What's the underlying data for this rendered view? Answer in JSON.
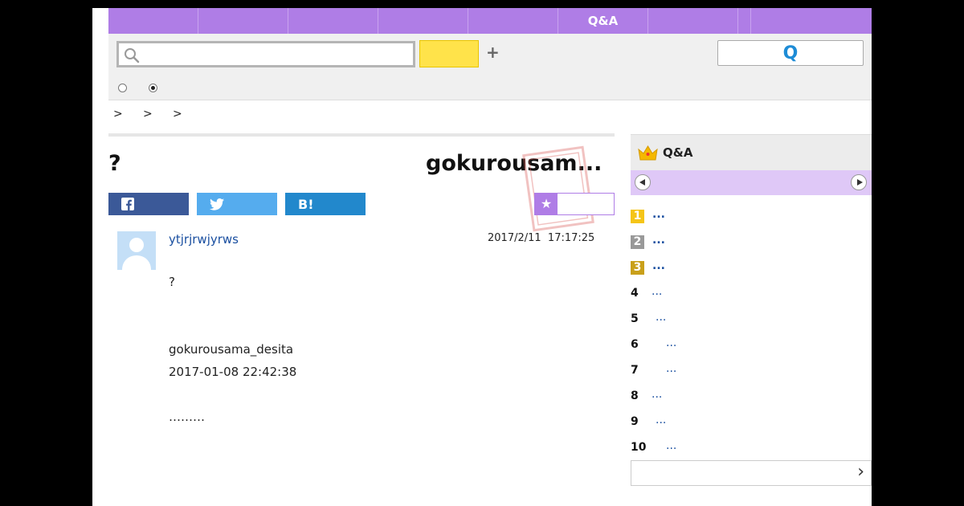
{
  "nav": {
    "items": [
      "",
      "",
      "",
      "",
      "",
      "Q&A",
      "",
      "",
      ""
    ]
  },
  "search": {
    "placeholder": "",
    "value": "",
    "search_label": "",
    "plus_label": "+",
    "q_label": "Q"
  },
  "breadcrumb": [
    ">",
    ">",
    ">"
  ],
  "question": {
    "title_left": "?",
    "title_right": "gokurousam...",
    "share": {
      "facebook": "f",
      "twitter": "",
      "hatena": "B!"
    },
    "fav_icon": "★",
    "username": "ytjrjrwjyrws",
    "date": "2017/2/11  17:17:25",
    "body_q": "?",
    "body_user": "gokurousama_desita",
    "body_time": "2017-01-08 22:42:38",
    "body_dots": "………"
  },
  "sidebar": {
    "title": "Q&A",
    "rankings": [
      {
        "num": "1",
        "text": "..."
      },
      {
        "num": "2",
        "text": "..."
      },
      {
        "num": "3",
        "text": "..."
      },
      {
        "num": "4",
        "text": "..."
      },
      {
        "num": "5",
        "text": "..."
      },
      {
        "num": "6",
        "text": "..."
      },
      {
        "num": "7",
        "text": "..."
      },
      {
        "num": "8",
        "text": "..."
      },
      {
        "num": "9",
        "text": "..."
      },
      {
        "num": "10",
        "text": "..."
      }
    ]
  },
  "colors": {
    "accent": "#af7de6",
    "link": "#1a4fa0",
    "search_button": "#ffe34a"
  }
}
